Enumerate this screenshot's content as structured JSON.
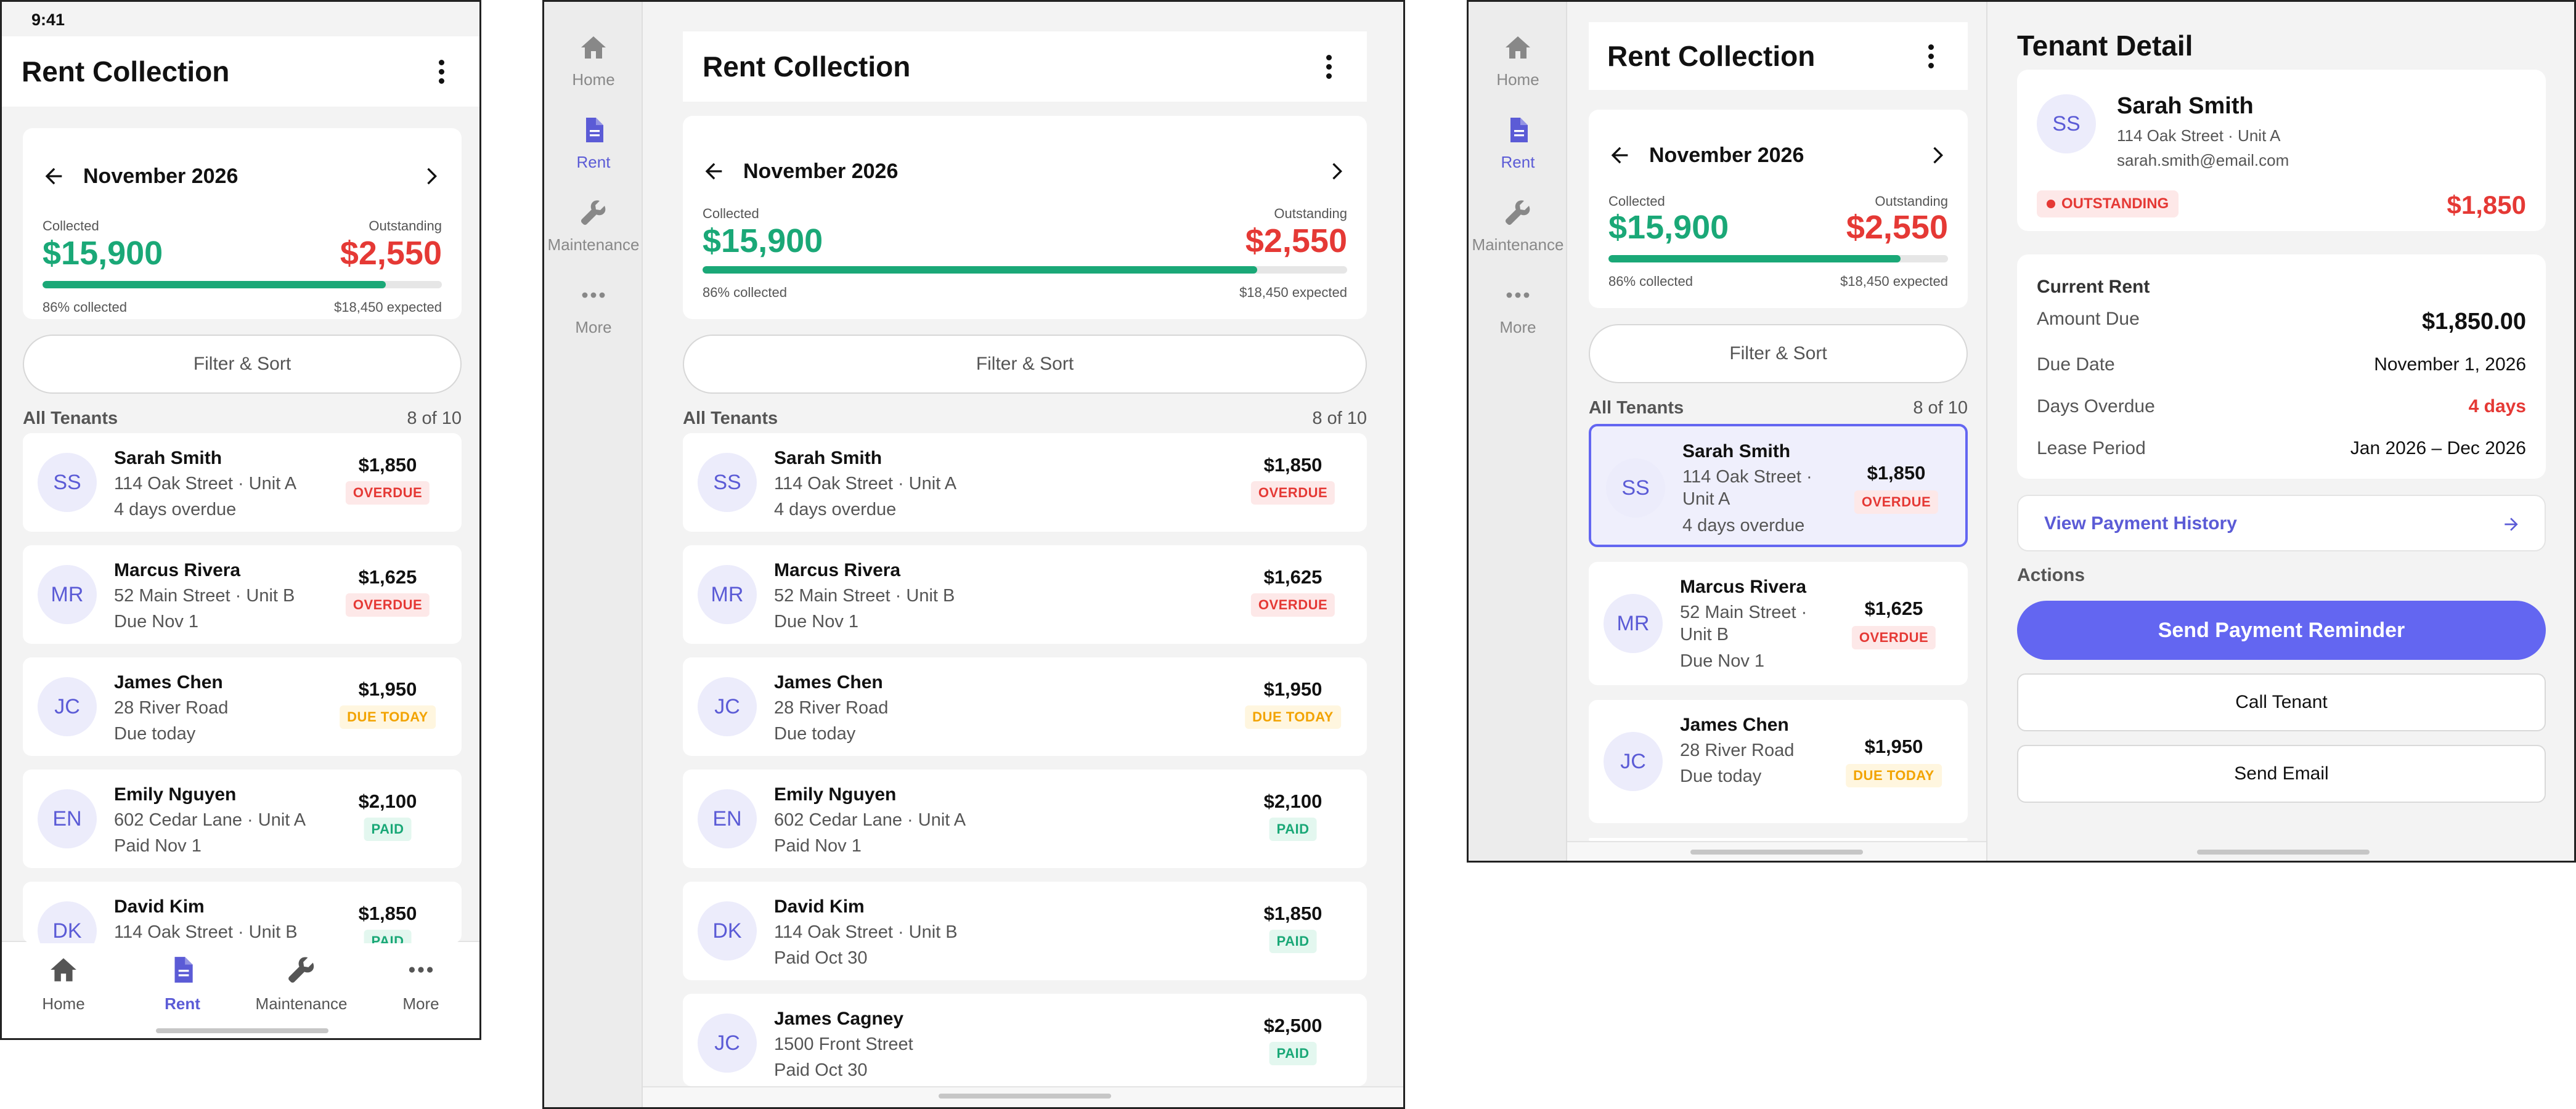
{
  "status": {
    "time": "9:41"
  },
  "app": {
    "title": "Rent Collection"
  },
  "summary": {
    "month": "November 2026",
    "collected_label": "Collected",
    "collected": "$15,900",
    "outstanding_label": "Outstanding",
    "outstanding": "$2,550",
    "progress_fraction": 0.86,
    "percent_text": "86% collected",
    "expected_text": "$18,450 expected"
  },
  "filter": {
    "label": "Filter & Sort"
  },
  "list": {
    "heading": "All Tenants",
    "count": "8 of 10"
  },
  "tenants": [
    {
      "initials": "SS",
      "name": "Sarah Smith",
      "address": "114 Oak Street · Unit A",
      "status_text": "4 days overdue",
      "amount": "$1,850",
      "badge": "OVERDUE",
      "badge_type": "overdue"
    },
    {
      "initials": "MR",
      "name": "Marcus Rivera",
      "address": "52 Main Street · Unit B",
      "status_text": "Due Nov 1",
      "amount": "$1,625",
      "badge": "OVERDUE",
      "badge_type": "overdue"
    },
    {
      "initials": "JC",
      "name": "James Chen",
      "address": "28 River Road",
      "status_text": "Due today",
      "amount": "$1,950",
      "badge": "DUE TODAY",
      "badge_type": "today"
    },
    {
      "initials": "EN",
      "name": "Emily Nguyen",
      "address": "602 Cedar Lane · Unit A",
      "status_text": "Paid Nov 1",
      "amount": "$2,100",
      "badge": "PAID",
      "badge_type": "paid"
    },
    {
      "initials": "DK",
      "name": "David Kim",
      "address": "114 Oak Street · Unit B",
      "status_text": "Paid Oct 30",
      "amount": "$1,850",
      "badge": "PAID",
      "badge_type": "paid"
    },
    {
      "initials": "JC",
      "name": "James Cagney",
      "address": "1500 Front Street",
      "status_text": "Paid Oct 30",
      "amount": "$2,500",
      "badge": "PAID",
      "badge_type": "paid"
    }
  ],
  "wide_list": {
    "row0": {
      "addr1": "114 Oak Street ·",
      "addr2": "Unit A"
    },
    "row1": {
      "addr1": "52 Main Street ·",
      "addr2": "Unit B"
    }
  },
  "nav": [
    {
      "label": "Home",
      "icon": "home-icon"
    },
    {
      "label": "Rent",
      "icon": "document-icon"
    },
    {
      "label": "Maintenance",
      "icon": "wrench-icon"
    },
    {
      "label": "More",
      "icon": "more-icon"
    }
  ],
  "detail": {
    "title": "Tenant Detail",
    "initials": "SS",
    "name": "Sarah Smith",
    "address": "114 Oak Street · Unit A",
    "email": "sarah.smith@email.com",
    "status_badge": "OUTSTANDING",
    "amount": "$1,850",
    "current_rent_heading": "Current Rent",
    "rows": [
      {
        "key": "Amount Due",
        "value": "$1,850.00"
      },
      {
        "key": "Due Date",
        "value": "November 1, 2026"
      },
      {
        "key": "Days Overdue",
        "value": "4 days"
      },
      {
        "key": "Lease Period",
        "value": "Jan 2026 – Dec 2026"
      }
    ],
    "history_link": "View Payment History",
    "actions_heading": "Actions",
    "primary_action": "Send Payment Reminder",
    "call_action": "Call Tenant",
    "email_action": "Send Email"
  },
  "colors": {
    "accent": "#6366f1",
    "green": "#1aa877",
    "red": "#e53935",
    "amber": "#f2a300"
  }
}
